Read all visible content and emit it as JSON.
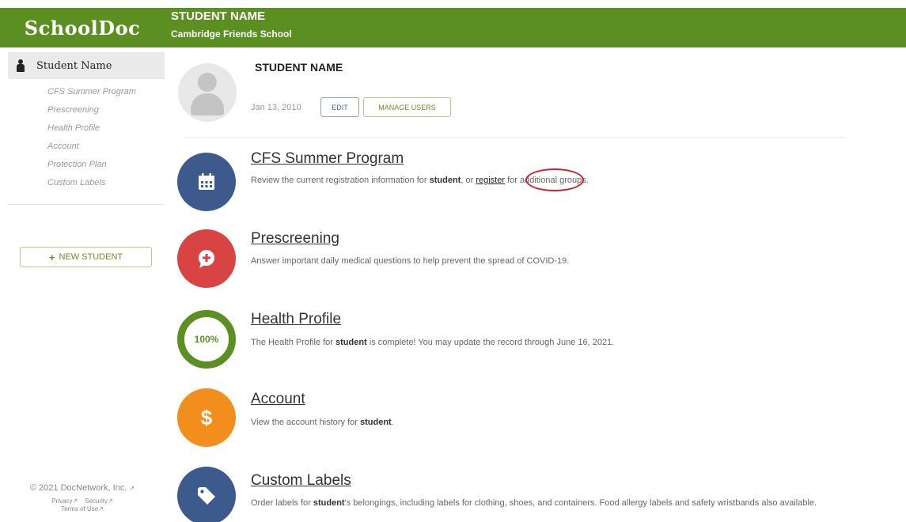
{
  "header": {
    "brand": "SchoolDoc",
    "student_name": "STUDENT NAME",
    "school": "Cambridge Friends School"
  },
  "sidebar": {
    "active_item": "Student Name",
    "items": [
      {
        "label": "CFS Summer Program"
      },
      {
        "label": "Prescreening"
      },
      {
        "label": "Health Profile"
      },
      {
        "label": "Account"
      },
      {
        "label": "Protection Plan"
      },
      {
        "label": "Custom Labels"
      }
    ],
    "new_student_label": "NEW STUDENT",
    "copyright": "© 2021 DocNetwork, Inc.",
    "links": [
      "Privacy",
      "Security",
      "Terms of Use"
    ]
  },
  "profile": {
    "name": "STUDENT NAME",
    "date": "Jan 13, 2010",
    "edit_label": "EDIT",
    "manage_users_label": "MANAGE USERS"
  },
  "modules": {
    "summer": {
      "title": "CFS Summer Program",
      "desc_before": "Review the current registration information for",
      "student": "student",
      "desc_mid": ", or",
      "link": "register",
      "desc_after": "for additional groups."
    },
    "prescreening": {
      "title": "Prescreening",
      "desc": "Answer important daily medical questions to help prevent the spread of COVID-19."
    },
    "health": {
      "title": "Health Profile",
      "percent": "100%",
      "desc_before": "The Health Profile for",
      "student": "student",
      "desc_after": "is complete! You may update the record through June 16, 2021."
    },
    "account": {
      "title": "Account",
      "symbol": "$",
      "desc_before": "View the account history for",
      "student": "student",
      "desc_after": "."
    },
    "labels": {
      "title": "Custom Labels",
      "desc_before": "Order labels for",
      "student": "student",
      "desc_after": "'s belongings, including labels for clothing, shoes, and containers. Food allergy labels and safety wristbands also available."
    }
  },
  "colors": {
    "brand_green": "#5b8f22",
    "navy": "#3d5a8c",
    "red": "#d84343",
    "orange": "#f28e1b",
    "annotation_red": "#d0202c"
  },
  "icons": {
    "calendar": "calendar-icon",
    "chat": "chat-plus-icon",
    "tag": "tag-icon",
    "person": "person-icon"
  }
}
